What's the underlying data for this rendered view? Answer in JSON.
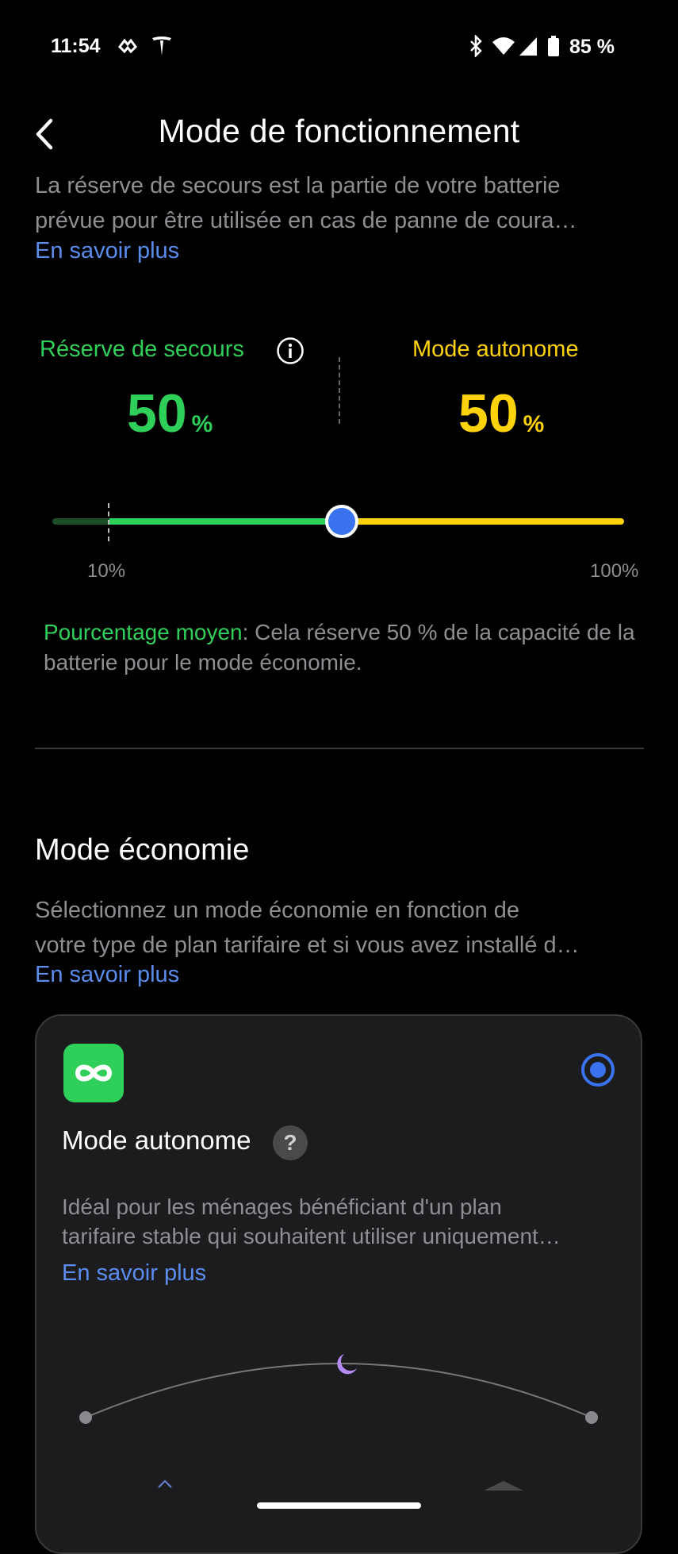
{
  "status_bar": {
    "time": "11:54",
    "battery": "85 %"
  },
  "header": {
    "back_icon": "chevron-left-icon",
    "title": "Mode de fonctionnement"
  },
  "reserve_section": {
    "description_line1": "La réserve de secours est la partie de votre batterie",
    "description_line2": "prévue pour être utilisée en cas de panne de coura…",
    "learn_more": "En savoir plus",
    "backup_label": "Réserve de secours",
    "backup_value": "50",
    "backup_unit": "%",
    "autonomous_label": "Mode autonome",
    "autonomous_value": "50",
    "autonomous_unit": "%",
    "slider": {
      "value_percent": 50,
      "min_label": "10%",
      "max_label": "100%"
    },
    "summary_highlight": "Pourcentage moyen",
    "summary_text": ": Cela réserve 50 % de la capacité de la batterie pour le mode économie."
  },
  "economy_section": {
    "title": "Mode économie",
    "description_line1": "Sélectionnez un mode économie en fonction de",
    "description_line2": "votre type de plan tarifaire et si vous avez installé d…",
    "learn_more": "En savoir plus",
    "card": {
      "title": "Mode autonome",
      "help_symbol": "?",
      "selected": true,
      "description_line1": "Idéal pour les ménages bénéficiant d'un plan",
      "description_line2": "tarifaire stable qui souhaitent utiliser uniquement…",
      "learn_more": "En savoir plus"
    }
  },
  "colors": {
    "green": "#2fd05a",
    "yellow": "#ffd20a",
    "blue": "#3b72f0",
    "link": "#5b8def"
  }
}
